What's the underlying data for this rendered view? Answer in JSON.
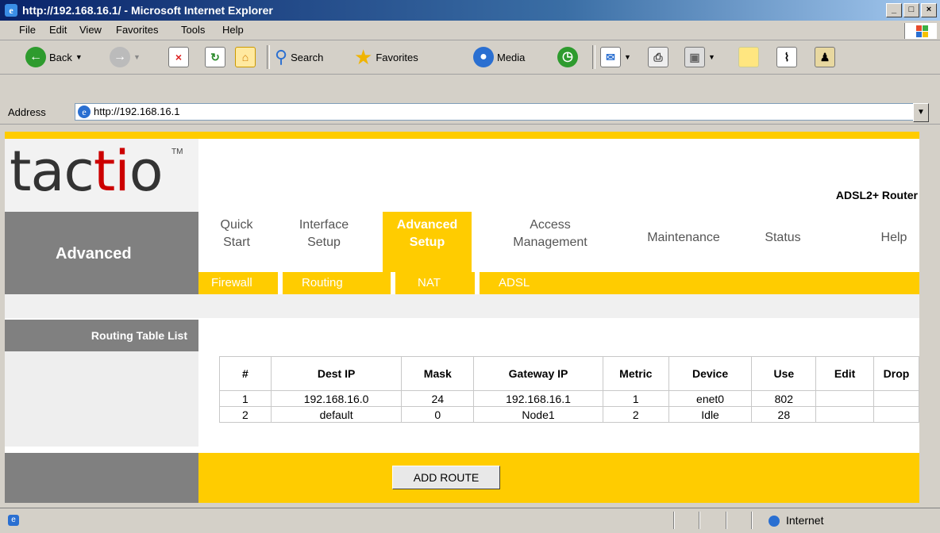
{
  "window": {
    "title": "http://192.168.16.1/ - Microsoft Internet Explorer"
  },
  "menu": [
    "File",
    "Edit",
    "View",
    "Favorites",
    "Tools",
    "Help"
  ],
  "toolbar": {
    "back": "Back",
    "search": "Search",
    "favorites": "Favorites",
    "media": "Media"
  },
  "address": {
    "label": "Address",
    "url": "http://192.168.16.1"
  },
  "brand": {
    "logo_a": "tac",
    "logo_ti": "ti",
    "logo_o": "o",
    "tm": "TM",
    "product": "ADSL2+ Router"
  },
  "nav": {
    "section": "Advanced",
    "tabs": [
      {
        "line1": "Quick",
        "line2": "Start"
      },
      {
        "line1": "Interface",
        "line2": "Setup"
      },
      {
        "line1": "Advanced",
        "line2": "Setup"
      },
      {
        "line1": "Access",
        "line2": "Management"
      },
      {
        "line1": "Maintenance",
        "line2": ""
      },
      {
        "line1": "Status",
        "line2": ""
      },
      {
        "line1": "Help",
        "line2": ""
      }
    ],
    "subtabs": [
      "Firewall",
      "Routing",
      "NAT",
      "ADSL"
    ]
  },
  "routing": {
    "label": "Routing Table List",
    "headers": [
      "#",
      "Dest IP",
      "Mask",
      "Gateway IP",
      "Metric",
      "Device",
      "Use",
      "Edit",
      "Drop"
    ],
    "rows": [
      [
        "1",
        "192.168.16.0",
        "24",
        "192.168.16.1",
        "1",
        "enet0",
        "802",
        "",
        ""
      ],
      [
        "2",
        "default",
        "0",
        "Node1",
        "2",
        "Idle",
        "28",
        "",
        ""
      ]
    ],
    "add_button": "ADD ROUTE"
  },
  "status": {
    "zone": "Internet"
  },
  "colors": {
    "accent": "#ffcc00",
    "nav_grey": "#808080",
    "logo_red": "#cc0000"
  }
}
